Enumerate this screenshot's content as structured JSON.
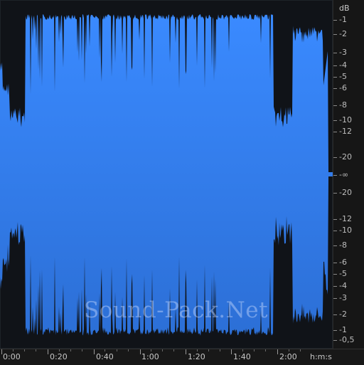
{
  "waveform": {
    "fill_top": "#3a8aff",
    "fill_bottom": "#2c6fd6",
    "background": "#101318"
  },
  "db_scale": {
    "unit": "dB",
    "labels": [
      "-1",
      "-2",
      "-3",
      "-4",
      "-5",
      "-6",
      "-8",
      "-10",
      "-12",
      "-20",
      "-∞",
      "-20",
      "-12",
      "-10",
      "-8",
      "-6",
      "-5",
      "-4",
      "-3",
      "-2",
      "-1",
      "-0,5"
    ]
  },
  "time_ruler": {
    "labels": [
      "0:00",
      "0:20",
      "0:40",
      "1:00",
      "1:20",
      "1:40",
      "2:00"
    ],
    "unit": "h:m:s"
  },
  "watermark": "Sound-Pack.Net"
}
